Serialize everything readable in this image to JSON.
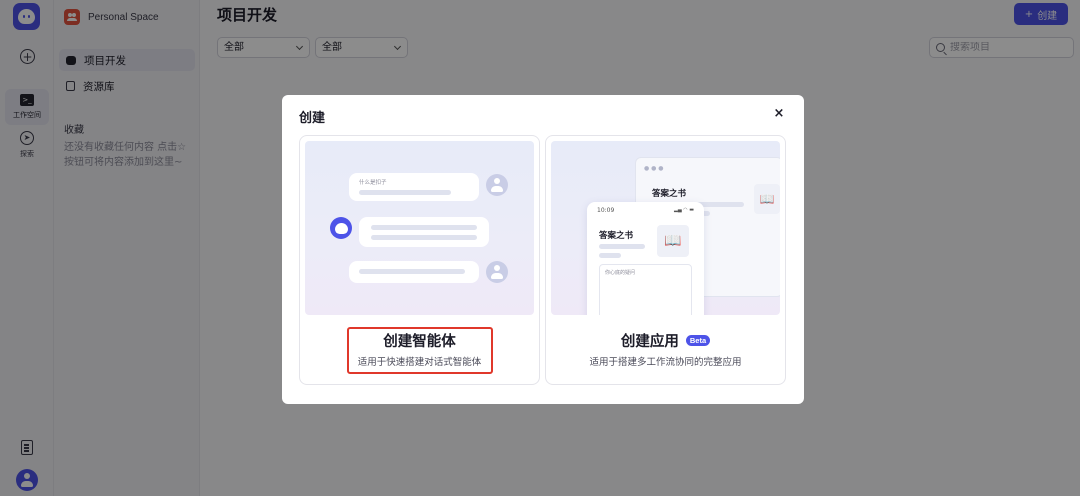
{
  "rail": {
    "workspace_label": "工作空间",
    "explore_label": "探索"
  },
  "sidebar": {
    "space_name": "Personal Space",
    "items": [
      {
        "label": "项目开发"
      },
      {
        "label": "资源库"
      }
    ],
    "collection_title": "收藏",
    "collection_empty": "还没有收藏任何内容 点击☆按钮可将内容添加到这里~"
  },
  "main": {
    "title": "项目开发",
    "create_label": "创建",
    "filters": [
      "全部",
      "全部"
    ],
    "search_placeholder": "搜索项目"
  },
  "modal": {
    "title": "创建",
    "close_icon": "×",
    "cards": [
      {
        "title": "创建智能体",
        "desc": "适用于快速搭建对话式智能体",
        "illustration": {
          "question_label": "什么是扣子"
        }
      },
      {
        "title": "创建应用",
        "badge": "Beta",
        "desc": "适用于搭建多工作流协同的完整应用",
        "illustration": {
          "app_name": "答案之书",
          "phone_time": "10:09",
          "input_hint": "你心底的疑问"
        }
      }
    ]
  },
  "colors": {
    "accent": "#4d53e8",
    "highlight": "#e0382b",
    "space_icon": "#e2533e"
  }
}
